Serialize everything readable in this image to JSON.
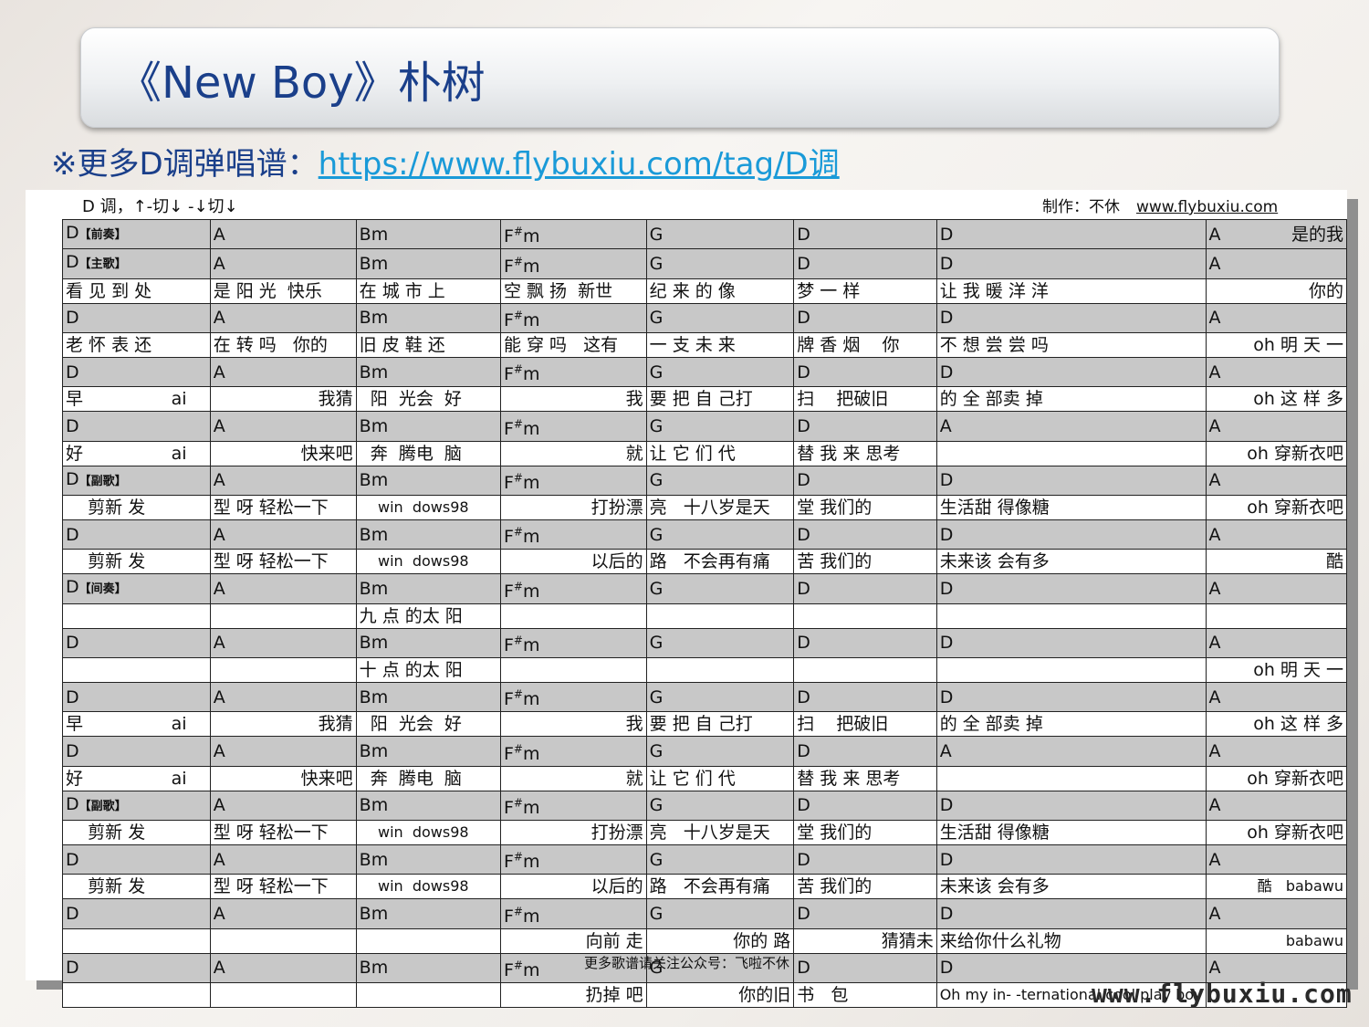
{
  "title": "《New Boy》朴树",
  "subline": {
    "prefix": "※更多D调弹唱谱：",
    "link": "https://www.flybuxiu.com/tag/D调"
  },
  "sheet": {
    "key_note": "D 调，↑-切↓ -↓切↓",
    "credit": "制作：不休",
    "credit_site": "www.flybuxiu.com",
    "footer": "更多歌谱请关注公众号：飞啦不休",
    "rows": [
      {
        "type": "c",
        "cells": [
          "D",
          "A",
          "Bm",
          "F#m",
          "G",
          "D",
          "D",
          "A"
        ],
        "tag": "【前奏】",
        "last_right": "是的我"
      },
      {
        "type": "c",
        "cells": [
          "D",
          "A",
          "Bm",
          "F#m",
          "G",
          "D",
          "D",
          "A"
        ],
        "tag": "【主歌】"
      },
      {
        "type": "l",
        "cells": [
          "看 见 到 处",
          "是 阳 光  快乐",
          "在 城 市 上",
          "空 飘 扬  新世",
          "纪 来 的 像",
          "梦 一 样",
          "让 我 暖 洋 洋",
          "你的"
        ]
      },
      {
        "type": "c",
        "cells": [
          "D",
          "A",
          "Bm",
          "F#m",
          "G",
          "D",
          "D",
          "A"
        ]
      },
      {
        "type": "l",
        "cells": [
          "老 怀 表 还",
          "在 转 吗   你的",
          "旧 皮 鞋 还",
          "能 穿 吗   这有",
          "一 支 未 来",
          "牌 香 烟    你",
          "不 想 尝 尝 吗",
          "oh 明 天 一"
        ]
      },
      {
        "type": "c",
        "cells": [
          "D",
          "A",
          "Bm",
          "F#m",
          "G",
          "D",
          "D",
          "A"
        ]
      },
      {
        "type": "l",
        "cells": [
          "早                ai",
          "我猜",
          "  阳  光会  好",
          "我",
          "要 把 自 己打",
          "扫    把破旧",
          "的 全 部卖 掉",
          "oh 这 样 多"
        ]
      },
      {
        "type": "c",
        "cells": [
          "D",
          "A",
          "Bm",
          "F#m",
          "G",
          "D",
          "A",
          "A"
        ]
      },
      {
        "type": "l",
        "cells": [
          "好                ai",
          "快来吧",
          "  奔  腾电  脑",
          "就",
          "让 它 们 代",
          "替 我 来 思考",
          "",
          "oh 穿新衣吧"
        ]
      },
      {
        "type": "c",
        "cells": [
          "D",
          "A",
          "Bm",
          "F#m",
          "G",
          "D",
          "D",
          "A"
        ],
        "tag": "【副歌】"
      },
      {
        "type": "l",
        "cells": [
          "    剪新 发",
          "型 呀 轻松一下",
          "    win  dows98",
          "打扮漂",
          "亮   十八岁是天",
          "堂 我们的",
          "生活甜 得像糖",
          "oh 穿新衣吧"
        ]
      },
      {
        "type": "c",
        "cells": [
          "D",
          "A",
          "Bm",
          "F#m",
          "G",
          "D",
          "D",
          "A"
        ]
      },
      {
        "type": "l",
        "cells": [
          "    剪新 发",
          "型 呀 轻松一下",
          "    win  dows98",
          "以后的",
          "路   不会再有痛",
          "苦 我们的",
          "未来该 会有多",
          "  酷"
        ]
      },
      {
        "type": "c",
        "cells": [
          "D",
          "A",
          "Bm",
          "F#m",
          "G",
          "D",
          "D",
          "A"
        ],
        "tag": "【间奏】"
      },
      {
        "type": "l",
        "cells": [
          "",
          "",
          "九 点 的太 阳",
          "",
          "",
          "",
          "",
          ""
        ]
      },
      {
        "type": "c",
        "cells": [
          "D",
          "A",
          "Bm",
          "F#m",
          "G",
          "D",
          "D",
          "A"
        ]
      },
      {
        "type": "l",
        "cells": [
          "",
          "",
          "十 点 的太 阳",
          "",
          "",
          "",
          "",
          "oh 明 天 一"
        ]
      },
      {
        "type": "c",
        "cells": [
          "D",
          "A",
          "Bm",
          "F#m",
          "G",
          "D",
          "D",
          "A"
        ]
      },
      {
        "type": "l",
        "cells": [
          "早                ai",
          "我猜",
          "  阳  光会  好",
          "我",
          "要 把 自 己打",
          "扫    把破旧",
          "的 全 部卖 掉",
          "oh 这 样 多"
        ]
      },
      {
        "type": "c",
        "cells": [
          "D",
          "A",
          "Bm",
          "F#m",
          "G",
          "D",
          "A",
          "A"
        ]
      },
      {
        "type": "l",
        "cells": [
          "好                ai",
          "快来吧",
          "  奔  腾电  脑",
          "就",
          "让 它 们 代",
          "替 我 来 思考",
          "",
          "oh 穿新衣吧"
        ]
      },
      {
        "type": "c",
        "cells": [
          "D",
          "A",
          "Bm",
          "F#m",
          "G",
          "D",
          "D",
          "A"
        ],
        "tag": "【副歌】"
      },
      {
        "type": "l",
        "cells": [
          "    剪新 发",
          "型 呀 轻松一下",
          "    win  dows98",
          "打扮漂",
          "亮   十八岁是天",
          "堂 我们的",
          "生活甜 得像糖",
          "oh 穿新衣吧"
        ]
      },
      {
        "type": "c",
        "cells": [
          "D",
          "A",
          "Bm",
          "F#m",
          "G",
          "D",
          "D",
          "A"
        ]
      },
      {
        "type": "l",
        "cells": [
          "    剪新 发",
          "型 呀 轻松一下",
          "    win  dows98",
          "以后的",
          "路   不会再有痛",
          "苦 我们的",
          "未来该 会有多",
          "  酷   babawu"
        ]
      },
      {
        "type": "c",
        "cells": [
          "D",
          "A",
          "Bm",
          "F#m",
          "G",
          "D",
          "D",
          "A"
        ]
      },
      {
        "type": "l",
        "cells": [
          "",
          "",
          "",
          "向前 走",
          "你的 路",
          "猜猜未",
          "来给你什么礼物",
          "babawu"
        ]
      },
      {
        "type": "c",
        "cells": [
          "D",
          "A",
          "Bm",
          "F#m",
          "G",
          "D",
          "D",
          "A"
        ]
      },
      {
        "type": "l",
        "cells": [
          "",
          "",
          "",
          "扔掉 吧",
          "你的旧",
          "书   包",
          "Oh my in- -ternational cool play boy",
          ""
        ]
      }
    ]
  },
  "watermark": "www.flybuxiu.com"
}
